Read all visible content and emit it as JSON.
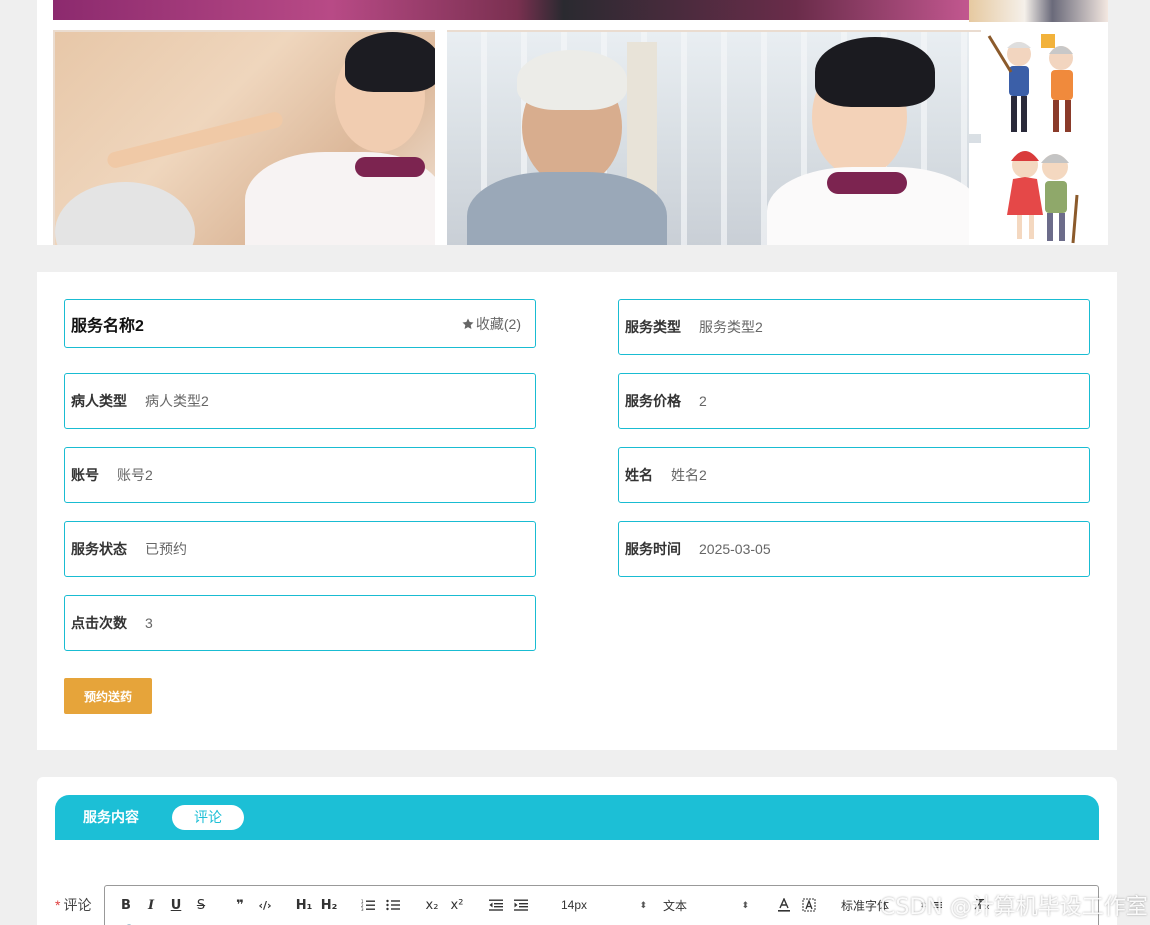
{
  "service": {
    "name": "服务名称2",
    "favorite_label": "收藏(2)"
  },
  "fields": {
    "service_type": {
      "label": "服务类型",
      "value": "服务类型2"
    },
    "patient_type": {
      "label": "病人类型",
      "value": "病人类型2"
    },
    "service_price": {
      "label": "服务价格",
      "value": "2"
    },
    "account": {
      "label": "账号",
      "value": "账号2"
    },
    "real_name": {
      "label": "姓名",
      "value": "姓名2"
    },
    "service_status": {
      "label": "服务状态",
      "value": "已预约"
    },
    "service_time": {
      "label": "服务时间",
      "value": "2025-03-05"
    },
    "click_count": {
      "label": "点击次数",
      "value": "3"
    }
  },
  "actions": {
    "book_label": "预约送药"
  },
  "tabs": {
    "content": "服务内容",
    "comment": "评论"
  },
  "comment": {
    "required_mark": "*",
    "label": "评论",
    "toolbar": {
      "font_size": "14px",
      "text_style": "文本",
      "font_family": "标准字体"
    }
  },
  "watermark": "CSDN @计算机毕设工作室",
  "colors": {
    "accent": "#1cbfd6",
    "button": "#e6a43a",
    "border": "#19bcd2"
  }
}
